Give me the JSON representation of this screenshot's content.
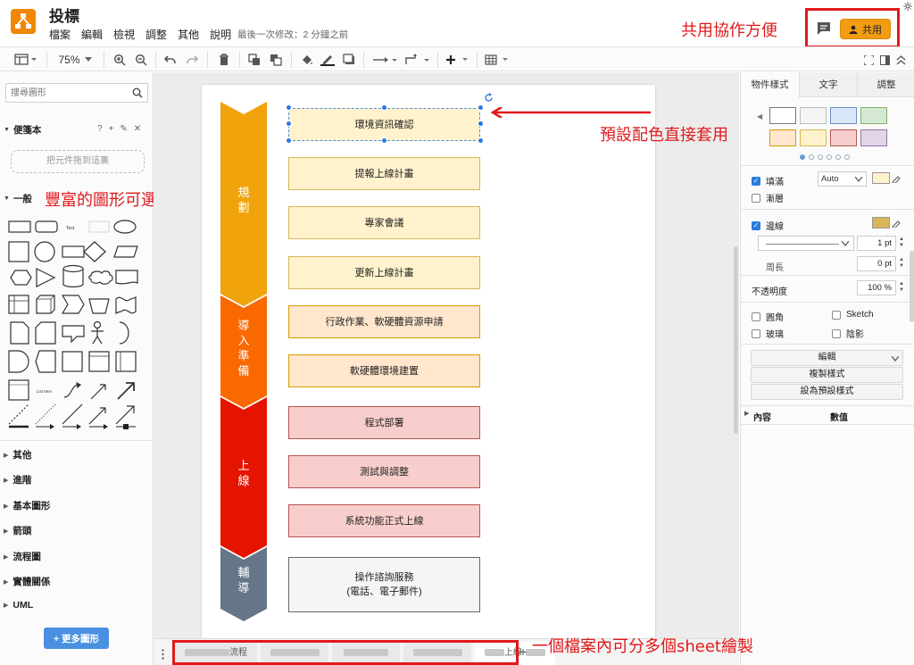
{
  "header": {
    "title": "投標",
    "menus": [
      "檔案",
      "編輯",
      "檢視",
      "調整",
      "其他",
      "說明"
    ],
    "last_modified": "最後一次修改：2 分鐘之前",
    "share_label": "共用"
  },
  "toolbar": {
    "zoom": "75%"
  },
  "left_panel": {
    "search_placeholder": "搜尋圖形",
    "scratchpad_title": "便箋本",
    "dropzone_text": "把元件拖到這裏",
    "general_title": "一般",
    "categories": [
      "其他",
      "進階",
      "基本圖形",
      "箭頭",
      "流程圖",
      "實體關係",
      "UML"
    ],
    "more_shapes": "+ 更多圖形"
  },
  "diagram": {
    "phases": [
      {
        "label": "規\n劃",
        "color": "#f0a30a"
      },
      {
        "label": "導\n入\n準\n備",
        "color": "#fa6800"
      },
      {
        "label": "上\n線",
        "color": "#e51400"
      },
      {
        "label": "輔\n導",
        "color": "#647687"
      }
    ],
    "steps": [
      {
        "text": "環境資訊確認"
      },
      {
        "text": "提報上線計畫"
      },
      {
        "text": "專家會議"
      },
      {
        "text": "更新上線計畫"
      },
      {
        "text": "行政作業、軟硬體資源申請"
      },
      {
        "text": "軟硬體環境建置"
      },
      {
        "text": "程式部署"
      },
      {
        "text": "測試與調整"
      },
      {
        "text": "系統功能正式上線"
      },
      {
        "text": "操作諮詢服務\n(電話、電子郵件)"
      }
    ]
  },
  "annotations": {
    "share": "共用協作方便",
    "shapes": "豐富的圖形可選",
    "colors": "預設配色直接套用",
    "sheets": "一個檔案內可分多個sheet繪製"
  },
  "right_panel": {
    "tabs": [
      "物件樣式",
      "文字",
      "調整"
    ],
    "swatch_colors": [
      "#ffffff",
      "#f5f5f5",
      "#dae8fc",
      "#d5e8d4",
      "#ffe6cc",
      "#fff2cc",
      "#f8cecc",
      "#e1d5e7"
    ],
    "fill_label": "填滿",
    "fill_mode": "Auto",
    "gradient_label": "漸層",
    "stroke_label": "邊線",
    "stroke_width": "1 pt",
    "perimeter_label": "周長",
    "perimeter_value": "0 pt",
    "opacity_label": "不透明度",
    "opacity_value": "100 %",
    "rounded_label": "圓角",
    "sketch_label": "Sketch",
    "glass_label": "玻璃",
    "shadow_label": "陰影",
    "edit_label": "編輯",
    "copy_style_label": "複製樣式",
    "set_default_label": "設為預設樣式",
    "prop_col": "內容",
    "value_col": "數值"
  },
  "sheet_bar": {
    "tabs": [
      "流程",
      "",
      "",
      "",
      "上線"
    ]
  }
}
